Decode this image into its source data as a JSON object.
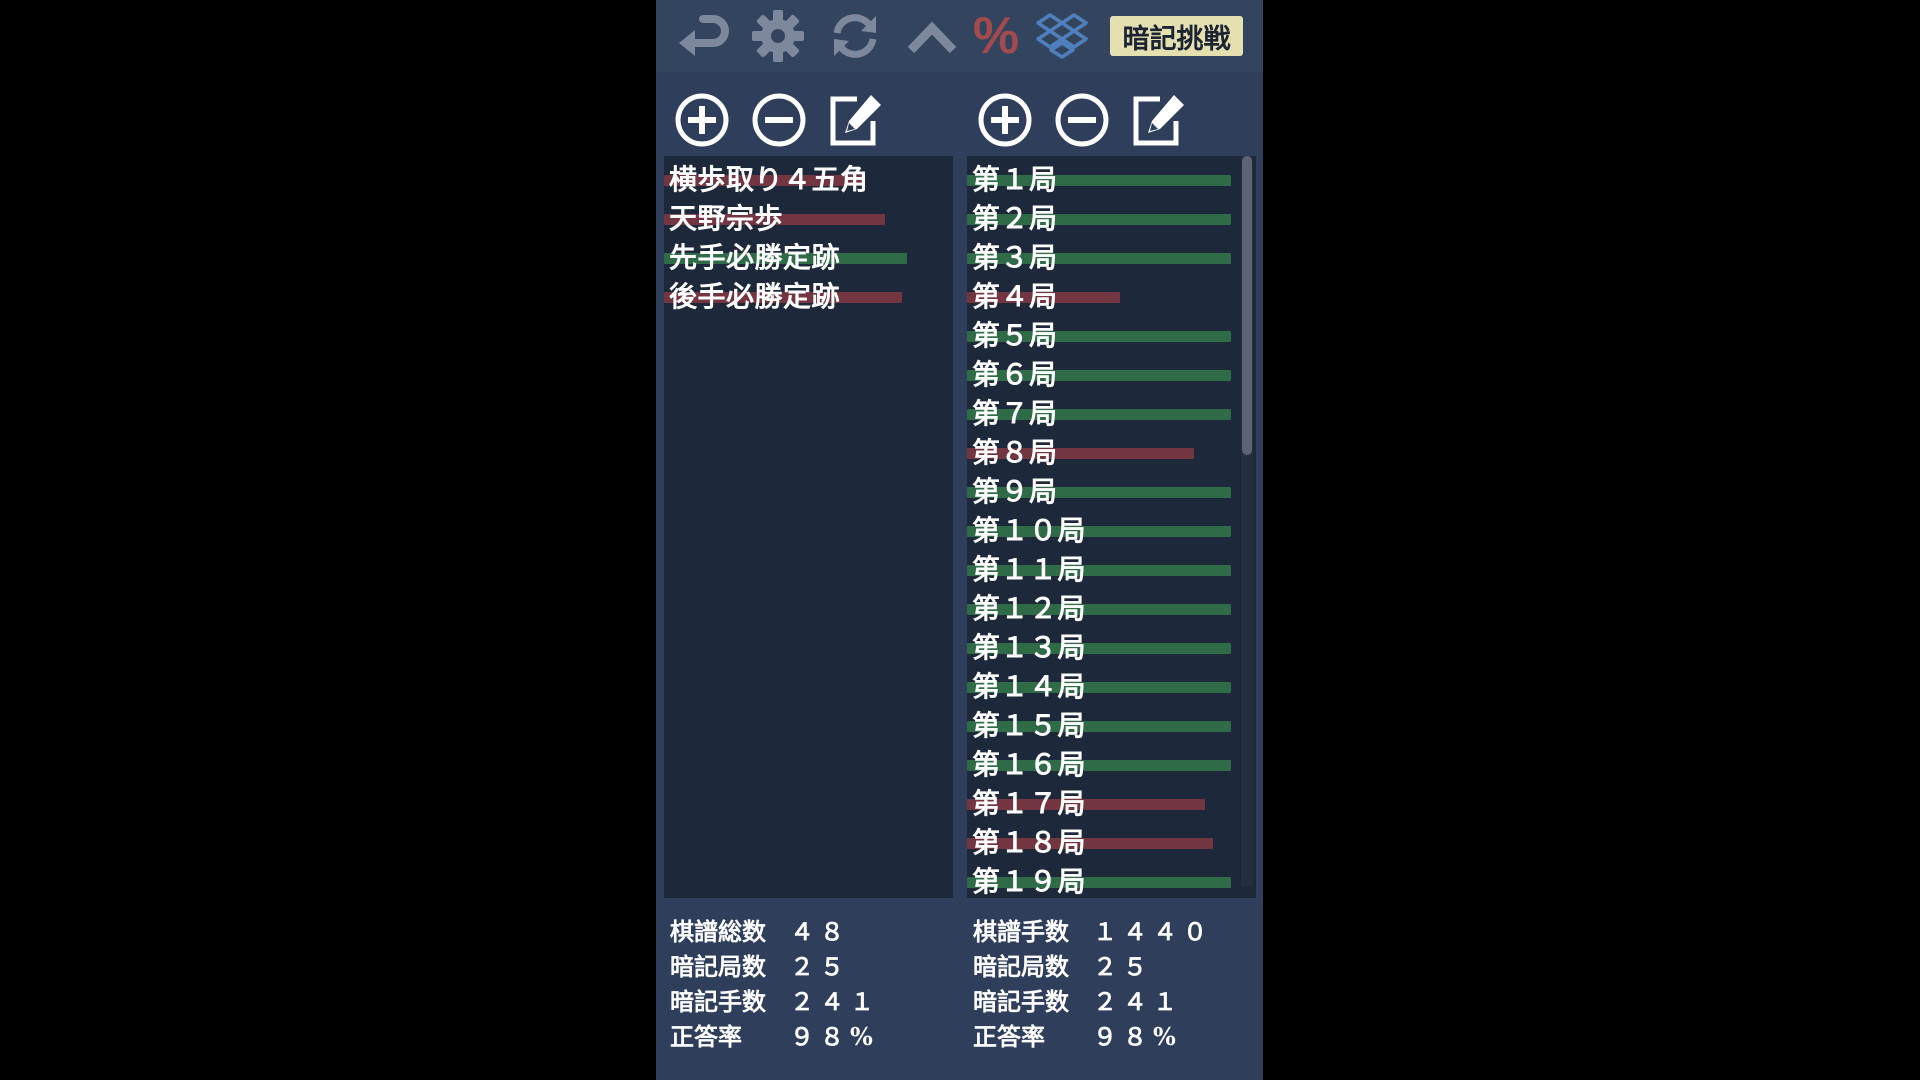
{
  "toolbar": {
    "icons": [
      "undo-icon",
      "gear-icon",
      "refresh-icon",
      "chevron-up-icon",
      "percent-icon",
      "dropbox-icon"
    ],
    "percent_symbol": "%",
    "challenge_label": "暗記挑戦"
  },
  "colors": {
    "background": "#2e3e5b",
    "panel": "#1e283b",
    "bar_green": "#2f6b47",
    "bar_red": "#733641",
    "challenge_button": "#e4e0b0",
    "icon_gray": "#7d889c",
    "percent_red": "#a34a4e",
    "dropbox_blue": "#4f7fbd"
  },
  "left_panel": {
    "controls": [
      "plus-icon",
      "minus-icon",
      "edit-icon"
    ],
    "items": [
      {
        "label": "横歩取り４五角",
        "score": 0.74,
        "status": "red"
      },
      {
        "label": "天野宗歩",
        "score": 0.82,
        "status": "red"
      },
      {
        "label": "先手必勝定跡",
        "score": 0.9,
        "status": "green"
      },
      {
        "label": "後手必勝定跡",
        "score": 0.88,
        "status": "red"
      }
    ]
  },
  "right_panel": {
    "controls": [
      "plus-icon",
      "minus-icon",
      "edit-icon"
    ],
    "items": [
      {
        "label": "第１局",
        "score": 1.0,
        "status": "green"
      },
      {
        "label": "第２局",
        "score": 1.0,
        "status": "green"
      },
      {
        "label": "第３局",
        "score": 1.0,
        "status": "green"
      },
      {
        "label": "第４局",
        "score": 0.58,
        "status": "red"
      },
      {
        "label": "第５局",
        "score": 1.0,
        "status": "green"
      },
      {
        "label": "第６局",
        "score": 1.0,
        "status": "green"
      },
      {
        "label": "第７局",
        "score": 1.0,
        "status": "green"
      },
      {
        "label": "第８局",
        "score": 0.86,
        "status": "red"
      },
      {
        "label": "第９局",
        "score": 1.0,
        "status": "green"
      },
      {
        "label": "第１０局",
        "score": 1.0,
        "status": "green"
      },
      {
        "label": "第１１局",
        "score": 1.0,
        "status": "green"
      },
      {
        "label": "第１２局",
        "score": 1.0,
        "status": "green"
      },
      {
        "label": "第１３局",
        "score": 1.0,
        "status": "green"
      },
      {
        "label": "第１４局",
        "score": 1.0,
        "status": "green"
      },
      {
        "label": "第１５局",
        "score": 1.0,
        "status": "green"
      },
      {
        "label": "第１６局",
        "score": 1.0,
        "status": "green"
      },
      {
        "label": "第１７局",
        "score": 0.9,
        "status": "red"
      },
      {
        "label": "第１８局",
        "score": 0.93,
        "status": "red"
      },
      {
        "label": "第１９局",
        "score": 1.0,
        "status": "green"
      }
    ],
    "scroll_fraction_visible": 0.41
  },
  "left_stats": [
    {
      "label": "棋譜総数",
      "value": "４８"
    },
    {
      "label": "暗記局数",
      "value": "２５"
    },
    {
      "label": "暗記手数",
      "value": "２４１"
    },
    {
      "label": "正答率",
      "value": "９８%"
    }
  ],
  "right_stats": [
    {
      "label": "棋譜手数",
      "value": "１４４０"
    },
    {
      "label": "暗記局数",
      "value": "２５"
    },
    {
      "label": "暗記手数",
      "value": "２４１"
    },
    {
      "label": "正答率",
      "value": "９８%"
    }
  ]
}
